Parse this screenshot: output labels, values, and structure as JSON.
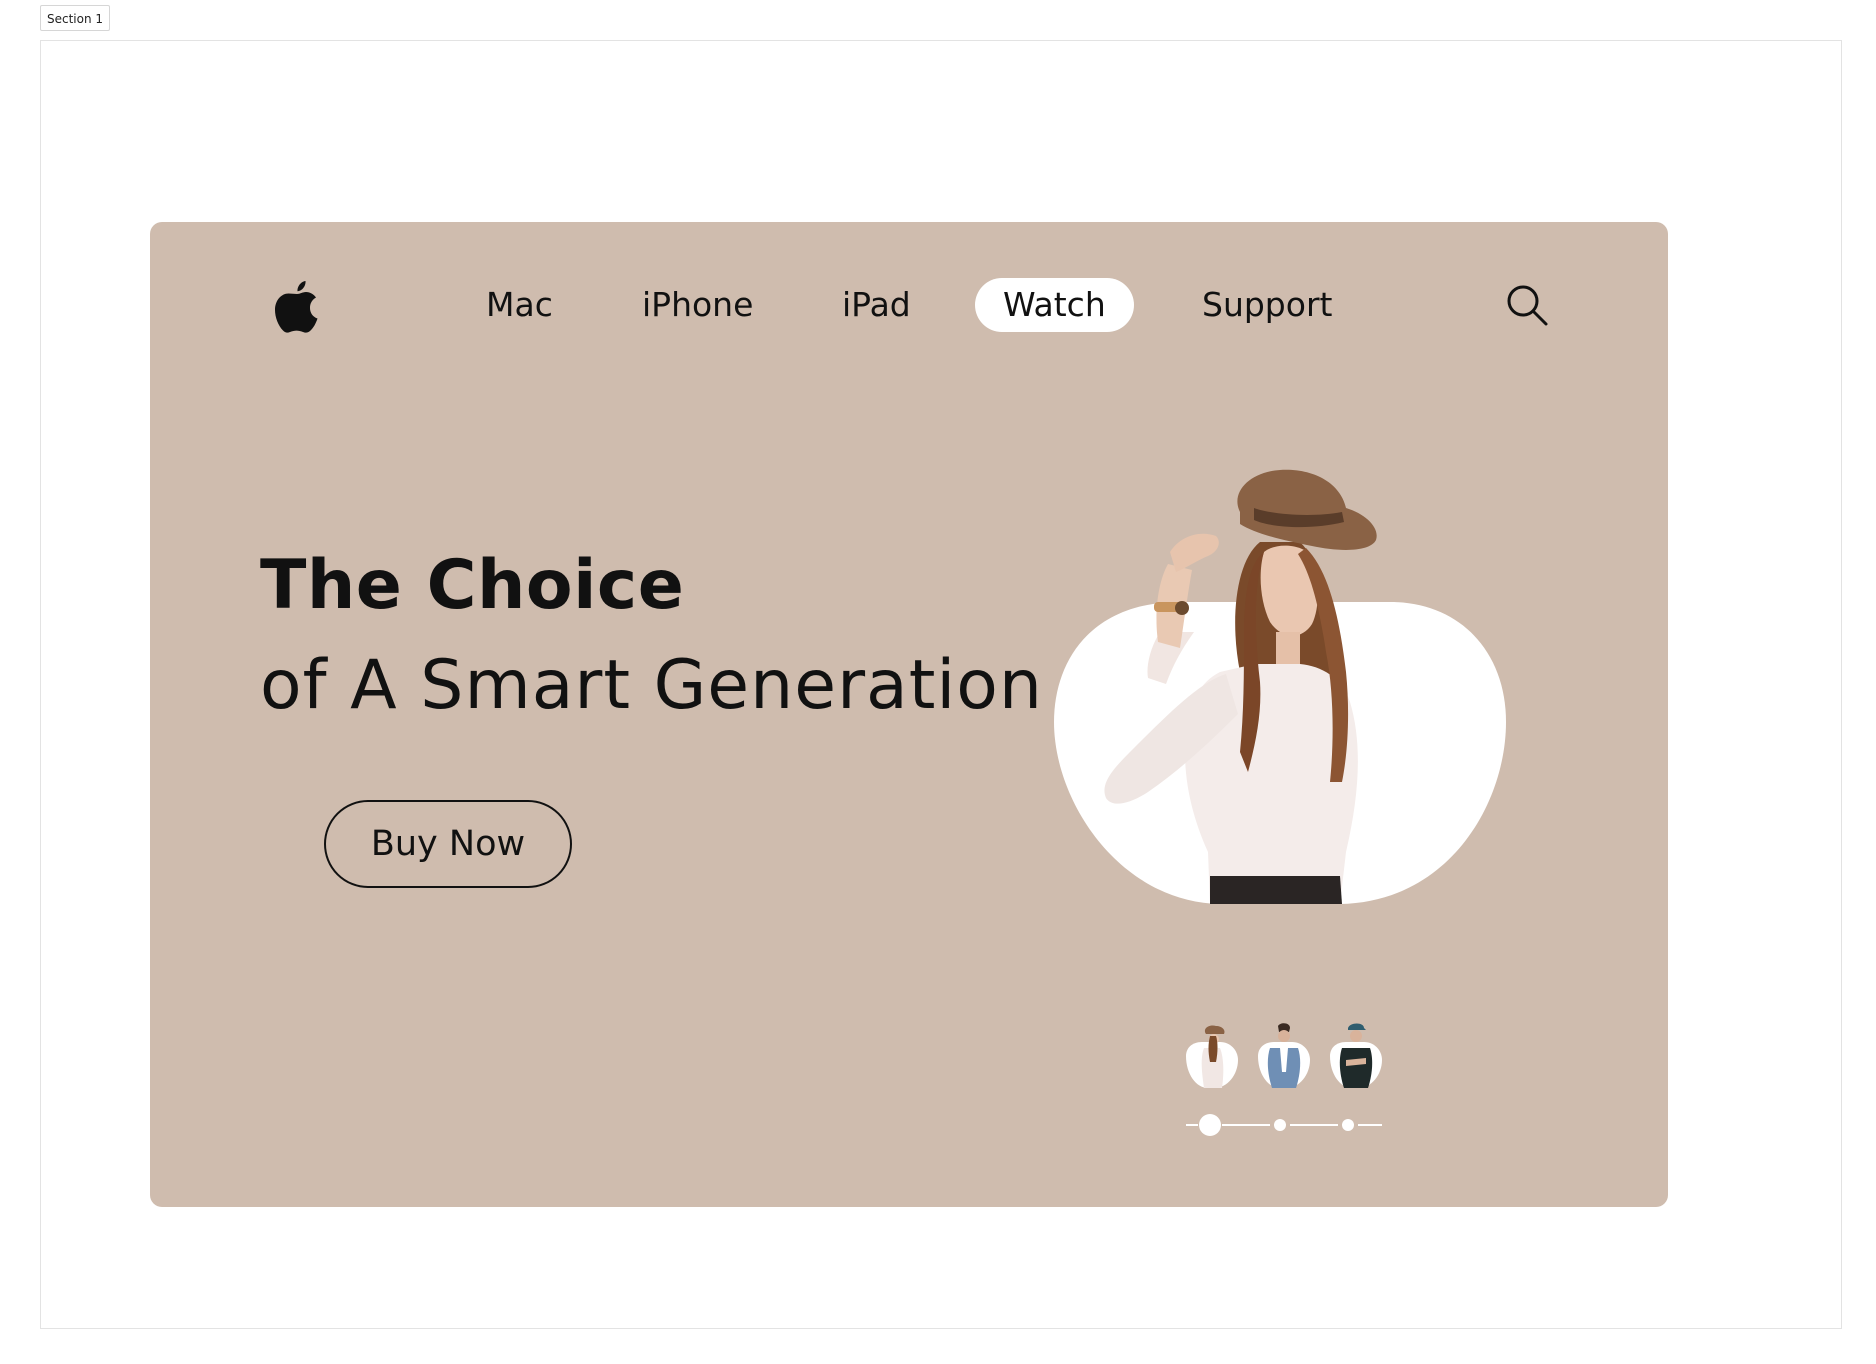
{
  "canvas": {
    "section_label": "Section 1"
  },
  "nav": {
    "logo": "apple-logo-icon",
    "items": [
      {
        "label": "Mac",
        "active": false
      },
      {
        "label": "iPhone",
        "active": false
      },
      {
        "label": "iPad",
        "active": false
      },
      {
        "label": "Watch",
        "active": true
      },
      {
        "label": "Support",
        "active": false
      }
    ],
    "search_icon": "search-icon"
  },
  "hero": {
    "headline_bold": "The Choice",
    "headline_light": "of A Smart Generation",
    "cta_label": "Buy Now",
    "background_color": "#cfbcae",
    "image": "woman-in-hat-photo"
  },
  "carousel": {
    "thumbnails": [
      {
        "image": "woman-in-hat-thumb",
        "selected": true
      },
      {
        "image": "man-in-denim-thumb",
        "selected": false
      },
      {
        "image": "man-in-cap-thumb",
        "selected": false
      }
    ],
    "active_index": 0,
    "count": 3
  }
}
